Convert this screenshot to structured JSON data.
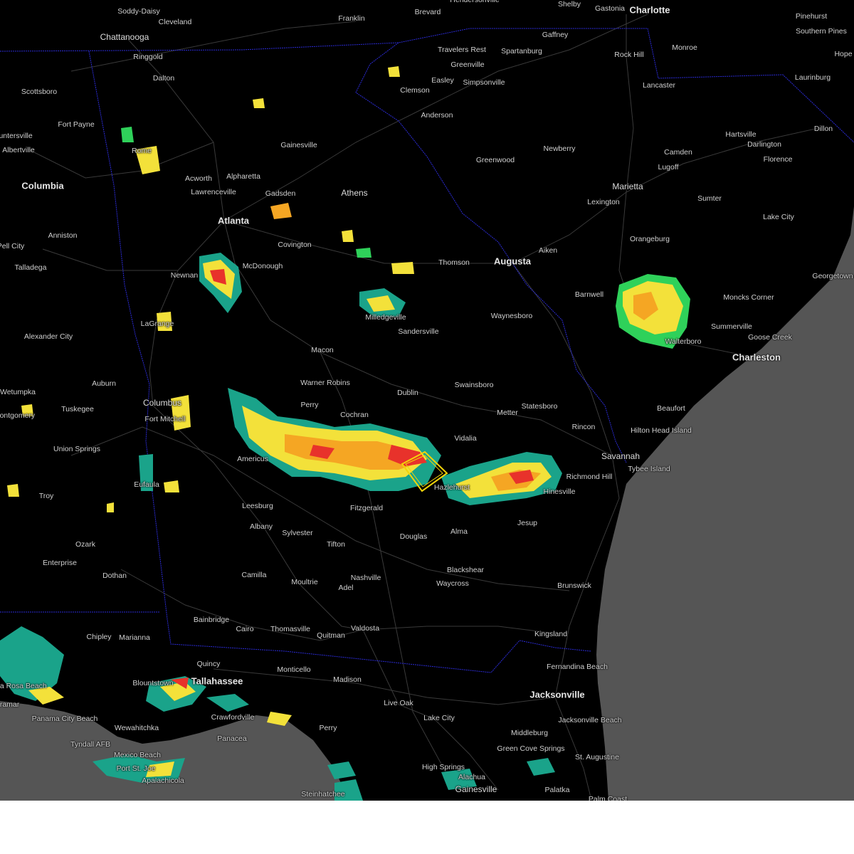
{
  "map": {
    "colors": {
      "land": "#000000",
      "ocean": "#555555",
      "roads": "#3a3a3a",
      "state_border": "#2b2bd6",
      "warning_box": "#f2d40a",
      "radar_light": "#1aa38a",
      "radar_green": "#2fd15a",
      "radar_yellow": "#f3e13a",
      "radar_orange": "#f5a623",
      "radar_red": "#e8322b"
    },
    "cities": [
      {
        "name": "Soddy-Daisy",
        "size": "small"
      },
      {
        "name": "Chattanooga",
        "size": "med"
      },
      {
        "name": "Cleveland",
        "size": "small"
      },
      {
        "name": "Ringgold",
        "size": "small"
      },
      {
        "name": "Franklin",
        "size": "small"
      },
      {
        "name": "Brevard",
        "size": "small"
      },
      {
        "name": "Hendersonville",
        "size": "small"
      },
      {
        "name": "Shelby",
        "size": "small"
      },
      {
        "name": "Gastonia",
        "size": "small"
      },
      {
        "name": "Charlotte",
        "size": "big"
      },
      {
        "name": "Pinehurst",
        "size": "small"
      },
      {
        "name": "Southern Pines",
        "size": "small"
      },
      {
        "name": "Gaffney",
        "size": "small"
      },
      {
        "name": "Travelers Rest",
        "size": "small"
      },
      {
        "name": "Spartanburg",
        "size": "small"
      },
      {
        "name": "Rock Hill",
        "size": "small"
      },
      {
        "name": "Monroe",
        "size": "small"
      },
      {
        "name": "Hope",
        "size": "small"
      },
      {
        "name": "Greenville",
        "size": "small"
      },
      {
        "name": "Easley",
        "size": "small"
      },
      {
        "name": "Simpsonville",
        "size": "small"
      },
      {
        "name": "Laurinburg",
        "size": "small"
      },
      {
        "name": "Dalton",
        "size": "small"
      },
      {
        "name": "Scottsboro",
        "size": "small"
      },
      {
        "name": "Clemson",
        "size": "small"
      },
      {
        "name": "Lancaster",
        "size": "small"
      },
      {
        "name": "Anderson",
        "size": "small"
      },
      {
        "name": "Fort Payne",
        "size": "small"
      },
      {
        "name": "Dillon",
        "size": "small"
      },
      {
        "name": "Guntersville",
        "size": "small"
      },
      {
        "name": "Hartsville",
        "size": "small"
      },
      {
        "name": "Albertville",
        "size": "small"
      },
      {
        "name": "Gainesville",
        "size": "small"
      },
      {
        "name": "Newberry",
        "size": "small"
      },
      {
        "name": "Darlington",
        "size": "small"
      },
      {
        "name": "Rome",
        "size": "small"
      },
      {
        "name": "Camden",
        "size": "small"
      },
      {
        "name": "Florence",
        "size": "small"
      },
      {
        "name": "Greenwood",
        "size": "small"
      },
      {
        "name": "Lugoff",
        "size": "small"
      },
      {
        "name": "Acworth",
        "size": "small"
      },
      {
        "name": "Alpharetta",
        "size": "small"
      },
      {
        "name": "Gadsden",
        "size": "small"
      },
      {
        "name": "Columbia",
        "size": "big"
      },
      {
        "name": "Marietta",
        "size": "med"
      },
      {
        "name": "Lawrenceville",
        "size": "small"
      },
      {
        "name": "Athens",
        "size": "med"
      },
      {
        "name": "Sumter",
        "size": "small"
      },
      {
        "name": "Lexington",
        "size": "small"
      },
      {
        "name": "Lake City",
        "size": "small"
      },
      {
        "name": "Atlanta",
        "size": "big"
      },
      {
        "name": "Anniston",
        "size": "small"
      },
      {
        "name": "Covington",
        "size": "small"
      },
      {
        "name": "Pell City",
        "size": "small"
      },
      {
        "name": "Aiken",
        "size": "small"
      },
      {
        "name": "Orangeburg",
        "size": "small"
      },
      {
        "name": "Talladega",
        "size": "small"
      },
      {
        "name": "McDonough",
        "size": "small"
      },
      {
        "name": "Augusta",
        "size": "big"
      },
      {
        "name": "Thomson",
        "size": "small"
      },
      {
        "name": "Georgetown",
        "size": "small"
      },
      {
        "name": "Newnan",
        "size": "small"
      },
      {
        "name": "Barnwell",
        "size": "small"
      },
      {
        "name": "Moncks Corner",
        "size": "small"
      },
      {
        "name": "Milledgeville",
        "size": "small"
      },
      {
        "name": "Waynesboro",
        "size": "small"
      },
      {
        "name": "LaGrange",
        "size": "small"
      },
      {
        "name": "Summerville",
        "size": "small"
      },
      {
        "name": "Goose Creek",
        "size": "small"
      },
      {
        "name": "Sandersville",
        "size": "small"
      },
      {
        "name": "Alexander City",
        "size": "small"
      },
      {
        "name": "Walterboro",
        "size": "small"
      },
      {
        "name": "Charleston",
        "size": "big"
      },
      {
        "name": "Macon",
        "size": "small"
      },
      {
        "name": "Warner Robins",
        "size": "small"
      },
      {
        "name": "Auburn",
        "size": "small"
      },
      {
        "name": "Swainsboro",
        "size": "small"
      },
      {
        "name": "Wetumpka",
        "size": "small"
      },
      {
        "name": "Dublin",
        "size": "small"
      },
      {
        "name": "Columbus",
        "size": "med"
      },
      {
        "name": "Tuskegee",
        "size": "small"
      },
      {
        "name": "Perry",
        "size": "small"
      },
      {
        "name": "Statesboro",
        "size": "small"
      },
      {
        "name": "Beaufort",
        "size": "small"
      },
      {
        "name": "Fort Mitchell",
        "size": "small"
      },
      {
        "name": "Montgomery",
        "size": "small"
      },
      {
        "name": "Cochran",
        "size": "small"
      },
      {
        "name": "Metter",
        "size": "small"
      },
      {
        "name": "Hilton Head Island",
        "size": "small"
      },
      {
        "name": "Rincon",
        "size": "small"
      },
      {
        "name": "Vidalia",
        "size": "small"
      },
      {
        "name": "Union Springs",
        "size": "small"
      },
      {
        "name": "Savannah",
        "size": "med"
      },
      {
        "name": "Americus",
        "size": "small"
      },
      {
        "name": "Tybee Island",
        "size": "small"
      },
      {
        "name": "Richmond Hill",
        "size": "small"
      },
      {
        "name": "Eufaula",
        "size": "small"
      },
      {
        "name": "Hazlehurst",
        "size": "small"
      },
      {
        "name": "Hinesville",
        "size": "small"
      },
      {
        "name": "Troy",
        "size": "small"
      },
      {
        "name": "Leesburg",
        "size": "small"
      },
      {
        "name": "Fitzgerald",
        "size": "small"
      },
      {
        "name": "Albany",
        "size": "small"
      },
      {
        "name": "Jesup",
        "size": "small"
      },
      {
        "name": "Alma",
        "size": "small"
      },
      {
        "name": "Sylvester",
        "size": "small"
      },
      {
        "name": "Douglas",
        "size": "small"
      },
      {
        "name": "Ozark",
        "size": "small"
      },
      {
        "name": "Tifton",
        "size": "small"
      },
      {
        "name": "Enterprise",
        "size": "small"
      },
      {
        "name": "Blackshear",
        "size": "small"
      },
      {
        "name": "Dothan",
        "size": "small"
      },
      {
        "name": "Camilla",
        "size": "small"
      },
      {
        "name": "Nashville",
        "size": "small"
      },
      {
        "name": "Waycross",
        "size": "small"
      },
      {
        "name": "Moultrie",
        "size": "small"
      },
      {
        "name": "Brunswick",
        "size": "small"
      },
      {
        "name": "Adel",
        "size": "small"
      },
      {
        "name": "Bainbridge",
        "size": "small"
      },
      {
        "name": "Cairo",
        "size": "small"
      },
      {
        "name": "Thomasville",
        "size": "small"
      },
      {
        "name": "Valdosta",
        "size": "small"
      },
      {
        "name": "Kingsland",
        "size": "small"
      },
      {
        "name": "Chipley",
        "size": "small"
      },
      {
        "name": "Marianna",
        "size": "small"
      },
      {
        "name": "Quitman",
        "size": "small"
      },
      {
        "name": "Quincy",
        "size": "small"
      },
      {
        "name": "Fernandina Beach",
        "size": "small"
      },
      {
        "name": "Monticello",
        "size": "small"
      },
      {
        "name": "Madison",
        "size": "small"
      },
      {
        "name": "Blountstown",
        "size": "small"
      },
      {
        "name": "Tallahassee",
        "size": "big"
      },
      {
        "name": "Santa Rosa Beach",
        "size": "small"
      },
      {
        "name": "Jacksonville",
        "size": "big"
      },
      {
        "name": "Miramar",
        "size": "small"
      },
      {
        "name": "Live Oak",
        "size": "small"
      },
      {
        "name": "Crawfordville",
        "size": "small"
      },
      {
        "name": "Jacksonville Beach",
        "size": "small"
      },
      {
        "name": "Panama City Beach",
        "size": "small"
      },
      {
        "name": "Lake City",
        "size": "small"
      },
      {
        "name": "Wewahitchka",
        "size": "small"
      },
      {
        "name": "Perry",
        "size": "small"
      },
      {
        "name": "Middleburg",
        "size": "small"
      },
      {
        "name": "Panacea",
        "size": "small"
      },
      {
        "name": "Tyndall AFB",
        "size": "small"
      },
      {
        "name": "Green Cove Springs",
        "size": "small"
      },
      {
        "name": "Mexico Beach",
        "size": "small"
      },
      {
        "name": "St. Augustine",
        "size": "small"
      },
      {
        "name": "Port St. Joe",
        "size": "small"
      },
      {
        "name": "High Springs",
        "size": "small"
      },
      {
        "name": "Alachua",
        "size": "small"
      },
      {
        "name": "Apalachicola",
        "size": "small"
      },
      {
        "name": "Gainesville",
        "size": "med"
      },
      {
        "name": "Palatka",
        "size": "small"
      },
      {
        "name": "Steinhatchee",
        "size": "small"
      },
      {
        "name": "Palm Coast",
        "size": "small"
      }
    ]
  }
}
